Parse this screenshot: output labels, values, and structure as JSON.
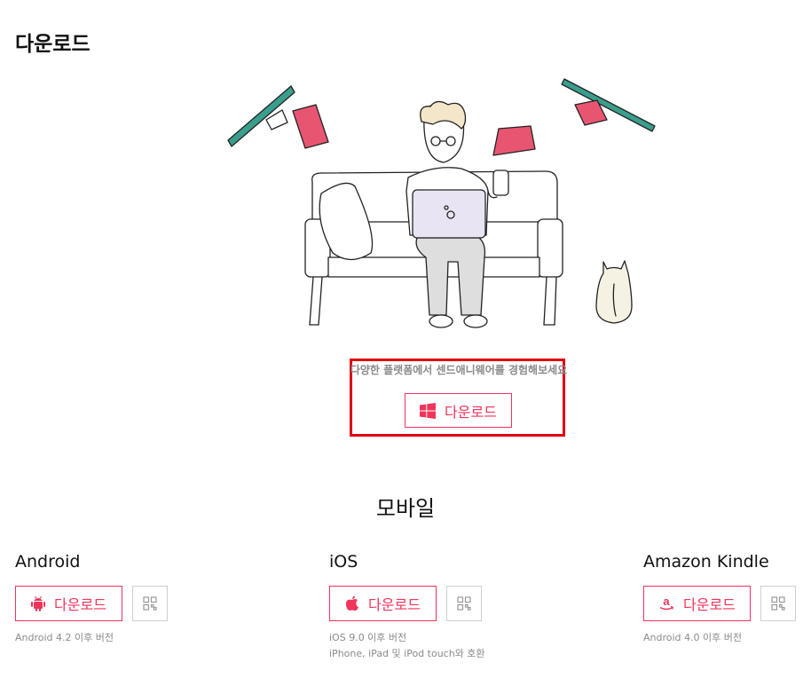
{
  "page": {
    "title": "다운로드"
  },
  "desktop": {
    "tagline": "다양한 플랫폼에서 센드애니웨어를 경험해보세요",
    "download_label": "다운로드",
    "icon": "windows-icon"
  },
  "mobile": {
    "section_title": "모바일",
    "platforms": [
      {
        "name": "Android",
        "download_label": "다운로드",
        "icon": "android-icon",
        "notes": [
          "Android 4.2 이후 버전"
        ]
      },
      {
        "name": "iOS",
        "download_label": "다운로드",
        "icon": "apple-icon",
        "notes": [
          "iOS 9.0 이후 버전",
          "iPhone, iPad 및 iPod touch와 호환"
        ]
      },
      {
        "name": "Amazon Kindle",
        "download_label": "다운로드",
        "icon": "amazon-icon",
        "notes": [
          "Android 4.0 이후 버전"
        ]
      }
    ]
  },
  "colors": {
    "accent": "#f0345a",
    "highlight": "#e00012",
    "muted_text": "#8a8a8a",
    "teal": "#3a9e8c",
    "paper": "#e85571"
  }
}
